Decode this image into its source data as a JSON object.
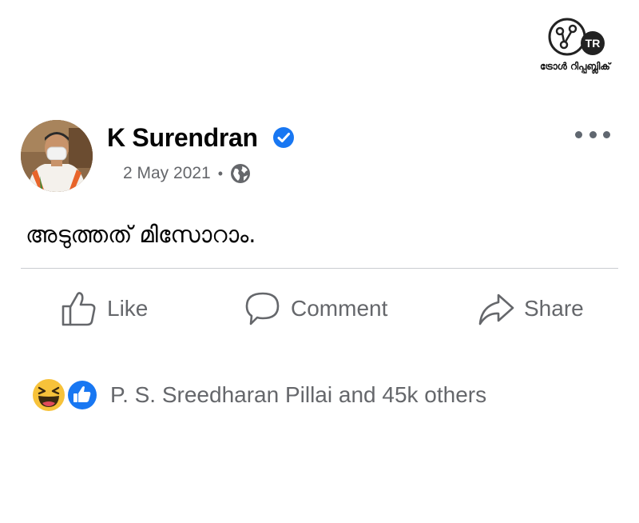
{
  "watermark": {
    "logo_text": "TR",
    "caption": "ട്രോൾ റിപ്പബ്ലിക്"
  },
  "post": {
    "author": "K Surendran",
    "verified": true,
    "date": "2 May 2021",
    "separator": "•",
    "privacy_icon": "globe-icon",
    "text": "അടുത്തത് മിസോറാം."
  },
  "actions": {
    "like_label": "Like",
    "comment_label": "Comment",
    "share_label": "Share"
  },
  "reactions": {
    "icons": [
      "haha-icon",
      "like-icon"
    ],
    "summary": "P. S. Sreedharan Pillai and 45k others"
  },
  "colors": {
    "facebook_blue": "#1877f2",
    "secondary_text": "#65676b",
    "haha_yellow": "#f7c23a",
    "divider": "#c9ccd1"
  }
}
